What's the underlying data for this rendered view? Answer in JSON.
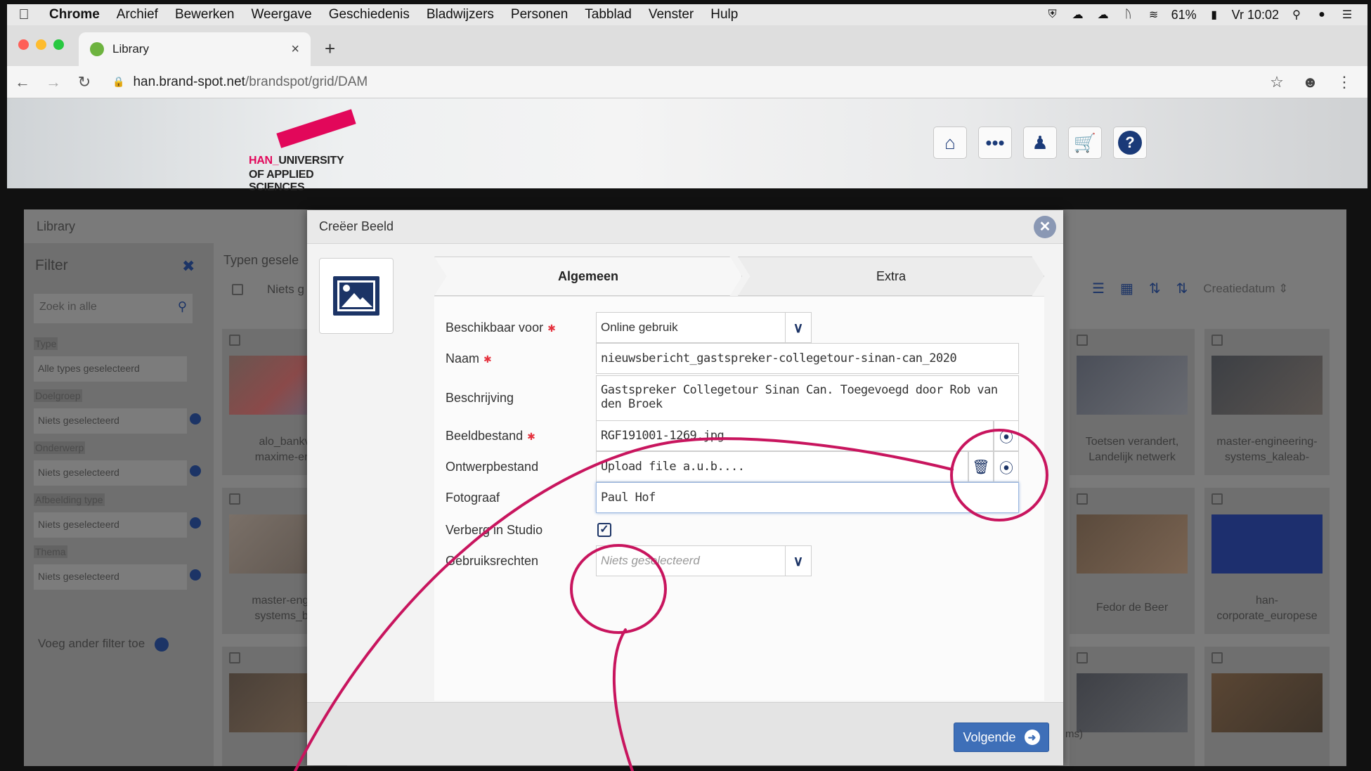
{
  "menubar": {
    "items": [
      "Chrome",
      "Archief",
      "Bewerken",
      "Weergave",
      "Geschiedenis",
      "Bladwijzers",
      "Personen",
      "Tabblad",
      "Venster",
      "Hulp"
    ],
    "battery": "61%",
    "clock": "Vr 10:02"
  },
  "browser": {
    "tab_title": "Library",
    "url_host": "han.brand-spot.net",
    "url_path": "/brandspot/grid/DAM"
  },
  "site": {
    "logo_line1_han": "HAN_",
    "logo_line1_rest": "UNIVERSITY",
    "logo_line2": "OF APPLIED SCIENCES",
    "brand_color": "#e2075a",
    "header_icons": [
      "home-icon",
      "more-icon",
      "user-icon",
      "cart-icon",
      "help-icon"
    ]
  },
  "library": {
    "title": "Library",
    "filter_title": "Filter",
    "search_placeholder": "Zoek in alle",
    "filters": [
      {
        "label": "Type",
        "value": "Alle types geselecteerd"
      },
      {
        "label": "Doelgroep",
        "value": "Niets geselecteerd"
      },
      {
        "label": "Onderwerp",
        "value": "Niets geselecteerd"
      },
      {
        "label": "Afbeelding type",
        "value": "Niets geselecteerd"
      },
      {
        "label": "Thema",
        "value": "Niets geselecteerd"
      }
    ],
    "add_filter": "Voeg ander filter toe",
    "typen_label": "Typen gesele",
    "niets_label": "Niets g",
    "sort_label": "Creatiedatum",
    "cards": [
      {
        "caption": "alo_bankv\nmaxime-en-"
      },
      {
        "caption": "master-engin\nsystems_bri"
      },
      {
        "caption": "Toetsen verandert,\nLandelijk netwerk"
      },
      {
        "caption": "master-engineering-\nsystems_kaleab-"
      },
      {
        "caption": "Fedor de Beer"
      },
      {
        "caption": "han-\ncorporate_europese"
      }
    ],
    "footer_fragment": "ms)"
  },
  "modal": {
    "title": "Creëer Beeld",
    "tabs": [
      "Algemeen",
      "Extra"
    ],
    "fields": {
      "beschikbaar_label": "Beschikbaar voor",
      "beschikbaar_value": "Online gebruik",
      "naam_label": "Naam",
      "naam_value": "nieuwsbericht_gastspreker-collegetour-sinan-can_2020",
      "beschrijving_label": "Beschrijving",
      "beschrijving_value": "Gastspreker Collegetour Sinan Can. Toegevoegd door Rob van den Broek",
      "beeldbestand_label": "Beeldbestand",
      "beeldbestand_value": "RGF191001-1269.jpg",
      "ontwerpbestand_label": "Ontwerpbestand",
      "ontwerpbestand_value": "Upload file a.u.b....",
      "fotograaf_label": "Fotograaf",
      "fotograaf_value": "Paul Hof",
      "verberg_label": "Verberg in Studio",
      "verberg_checked": true,
      "gebruiksrechten_label": "Gebruiksrechten",
      "gebruiksrechten_placeholder": "Niets geselecteerd"
    },
    "next_button": "Volgende"
  },
  "colors": {
    "accent": "#1c3466",
    "button": "#3e6fb8",
    "required": "#e5323e",
    "annotation": "#c8155e"
  }
}
